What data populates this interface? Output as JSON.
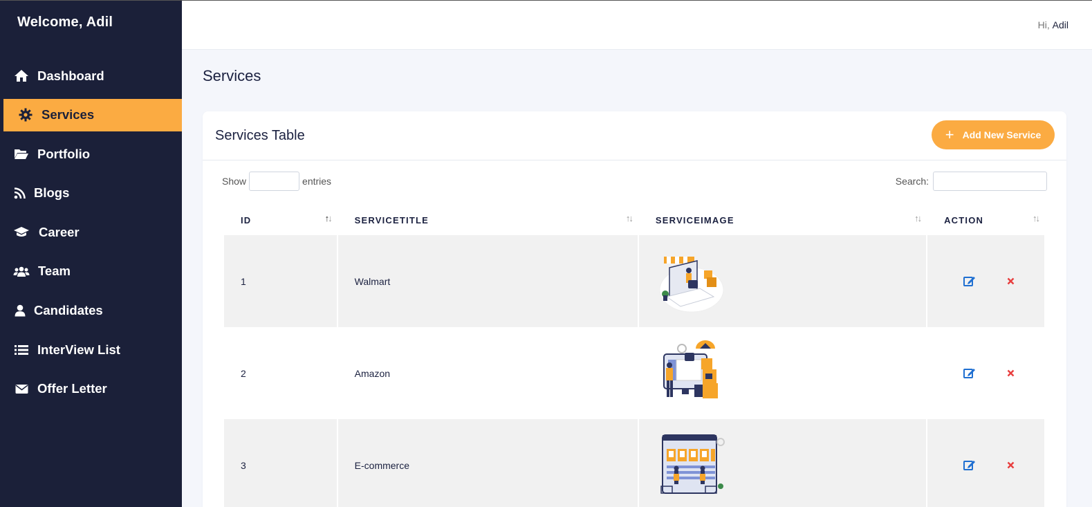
{
  "sidebar": {
    "welcome": "Welcome, Adil",
    "items": [
      {
        "label": "Dashboard",
        "icon": "home-icon"
      },
      {
        "label": "Services",
        "icon": "gear-icon",
        "active": true
      },
      {
        "label": "Portfolio",
        "icon": "folder-open-icon"
      },
      {
        "label": "Blogs",
        "icon": "rss-icon"
      },
      {
        "label": "Career",
        "icon": "graduation-cap-icon"
      },
      {
        "label": "Team",
        "icon": "users-icon"
      },
      {
        "label": "Candidates",
        "icon": "user-icon"
      },
      {
        "label": "InterView List",
        "icon": "list-icon"
      },
      {
        "label": "Offer Letter",
        "icon": "envelope-icon"
      }
    ]
  },
  "topbar": {
    "greeting_prefix": "Hi,",
    "user_name": "Adil"
  },
  "page": {
    "title": "Services"
  },
  "card": {
    "title": "Services Table",
    "add_button_label": "Add New Service",
    "show_label": "Show",
    "entries_label": "entries",
    "search_label": "Search:"
  },
  "table": {
    "columns": [
      "ID",
      "SERVICETITLE",
      "SERVICEIMAGE",
      "ACTION"
    ],
    "rows": [
      {
        "id": "1",
        "title": "Walmart",
        "image": "online-shopping-illustration"
      },
      {
        "id": "2",
        "title": "Amazon",
        "image": "delivery-illustration"
      },
      {
        "id": "3",
        "title": "E-commerce",
        "image": "ecommerce-store-illustration"
      }
    ]
  },
  "colors": {
    "sidebar_bg": "#1b2039",
    "accent": "#fbab42",
    "edit_icon": "#1f6fd1",
    "delete_icon": "#e83e3e"
  }
}
